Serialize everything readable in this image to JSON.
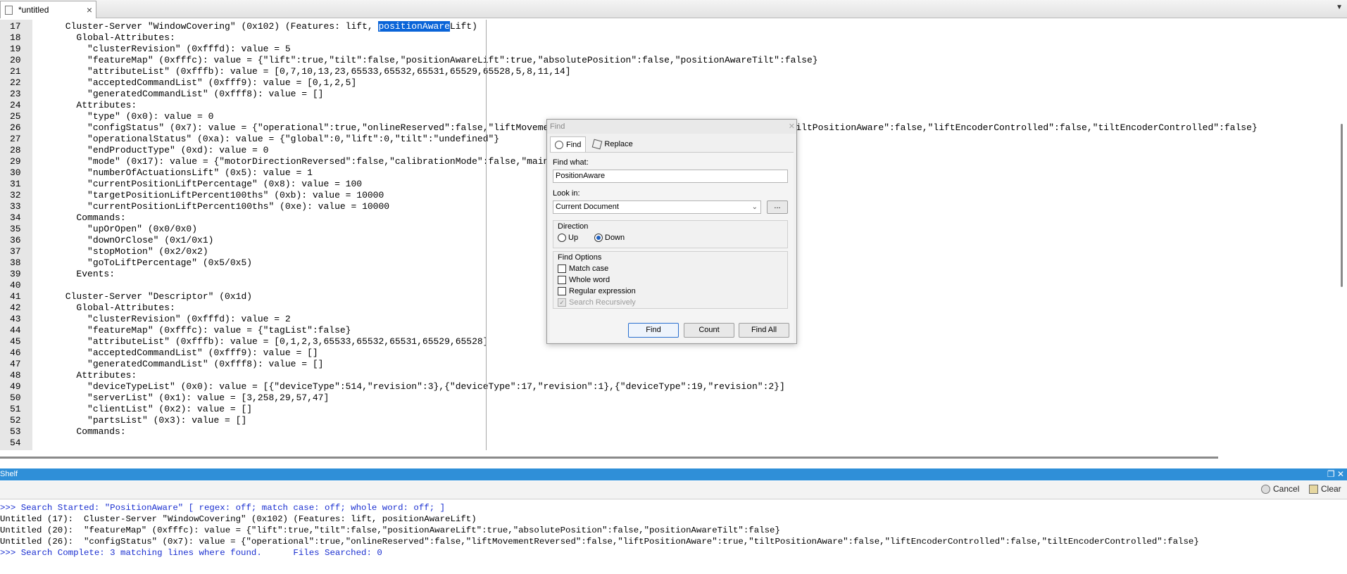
{
  "tab": {
    "title": "*untitled",
    "close": "×",
    "menu": "▼"
  },
  "editor": {
    "lines": [
      {
        "n": "17",
        "pre": "      Cluster-Server \"WindowCovering\" (0x102) (Features: lift, ",
        "sel": "positionAware",
        "post": "Lift)"
      },
      {
        "n": "18",
        "pre": "        Global-Attributes:"
      },
      {
        "n": "19",
        "pre": "          \"clusterRevision\" (0xfffd): value = 5"
      },
      {
        "n": "20",
        "pre": "          \"featureMap\" (0xfffc): value = {\"lift\":true,\"tilt\":false,\"positionAwareLift\":true,\"absolutePosition\":false,\"positionAwareTilt\":false}"
      },
      {
        "n": "21",
        "pre": "          \"attributeList\" (0xfffb): value = [0,7,10,13,23,65533,65532,65531,65529,65528,5,8,11,14]"
      },
      {
        "n": "22",
        "pre": "          \"acceptedCommandList\" (0xfff9): value = [0,1,2,5]"
      },
      {
        "n": "23",
        "pre": "          \"generatedCommandList\" (0xfff8): value = []"
      },
      {
        "n": "24",
        "pre": "        Attributes:"
      },
      {
        "n": "25",
        "pre": "          \"type\" (0x0): value = 0"
      },
      {
        "n": "26",
        "pre": "          \"configStatus\" (0x7): value = {\"operational\":true,\"onlineReserved\":false,\"liftMovementReversed\":false,\"liftPositionAware\":true,\"tiltPositionAware\":false,\"liftEncoderControlled\":false,\"tiltEncoderControlled\":false}"
      },
      {
        "n": "27",
        "pre": "          \"operationalStatus\" (0xa): value = {\"global\":0,\"lift\":0,\"tilt\":\"undefined\"}"
      },
      {
        "n": "28",
        "pre": "          \"endProductType\" (0xd): value = 0"
      },
      {
        "n": "29",
        "pre": "          \"mode\" (0x17): value = {\"motorDirectionReversed\":false,\"calibrationMode\":false,\"maintenanceMode\":false,\"ledFeedback\":false}"
      },
      {
        "n": "30",
        "pre": "          \"numberOfActuationsLift\" (0x5): value = 1"
      },
      {
        "n": "31",
        "pre": "          \"currentPositionLiftPercentage\" (0x8): value = 100"
      },
      {
        "n": "32",
        "pre": "          \"targetPositionLiftPercent100ths\" (0xb): value = 10000"
      },
      {
        "n": "33",
        "pre": "          \"currentPositionLiftPercent100ths\" (0xe): value = 10000"
      },
      {
        "n": "34",
        "pre": "        Commands:"
      },
      {
        "n": "35",
        "pre": "          \"upOrOpen\" (0x0/0x0)"
      },
      {
        "n": "36",
        "pre": "          \"downOrClose\" (0x1/0x1)"
      },
      {
        "n": "37",
        "pre": "          \"stopMotion\" (0x2/0x2)"
      },
      {
        "n": "38",
        "pre": "          \"goToLiftPercentage\" (0x5/0x5)"
      },
      {
        "n": "39",
        "pre": "        Events:"
      },
      {
        "n": "40",
        "pre": ""
      },
      {
        "n": "41",
        "pre": "      Cluster-Server \"Descriptor\" (0x1d)"
      },
      {
        "n": "42",
        "pre": "        Global-Attributes:"
      },
      {
        "n": "43",
        "pre": "          \"clusterRevision\" (0xfffd): value = 2"
      },
      {
        "n": "44",
        "pre": "          \"featureMap\" (0xfffc): value = {\"tagList\":false}"
      },
      {
        "n": "45",
        "pre": "          \"attributeList\" (0xfffb): value = [0,1,2,3,65533,65532,65531,65529,65528]"
      },
      {
        "n": "46",
        "pre": "          \"acceptedCommandList\" (0xfff9): value = []"
      },
      {
        "n": "47",
        "pre": "          \"generatedCommandList\" (0xfff8): value = []"
      },
      {
        "n": "48",
        "pre": "        Attributes:"
      },
      {
        "n": "49",
        "pre": "          \"deviceTypeList\" (0x0): value = [{\"deviceType\":514,\"revision\":3},{\"deviceType\":17,\"revision\":1},{\"deviceType\":19,\"revision\":2}]"
      },
      {
        "n": "50",
        "pre": "          \"serverList\" (0x1): value = [3,258,29,57,47]"
      },
      {
        "n": "51",
        "pre": "          \"clientList\" (0x2): value = []"
      },
      {
        "n": "52",
        "pre": "          \"partsList\" (0x3): value = []"
      },
      {
        "n": "53",
        "pre": "        Commands:"
      },
      {
        "n": "54",
        "pre": ""
      }
    ]
  },
  "find_dialog": {
    "title": "Find",
    "close": "✕",
    "tab_find": "Find",
    "tab_replace": "Replace",
    "find_what_label": "Find what:",
    "find_what_value": "PositionAware",
    "look_in_label": "Look in:",
    "look_in_value": "Current Document",
    "browse": "...",
    "direction_label": "Direction",
    "dir_up": "Up",
    "dir_down": "Down",
    "direction_selected": "Down",
    "options_label": "Find Options",
    "match_case": "Match case",
    "whole_word": "Whole word",
    "regex": "Regular expression",
    "search_recursively": "Search Recursively",
    "btn_find": "Find",
    "btn_count": "Count",
    "btn_find_all": "Find All"
  },
  "shelf": {
    "title": "Shelf",
    "cancel": "Cancel",
    "clear": "Clear",
    "output": [
      {
        "text": ">>> Search Started: \"PositionAware\" [ regex: off; match case: off; whole word: off; ]",
        "color": "#1a2fd0"
      },
      {
        "text": "Untitled (17):  Cluster-Server \"WindowCovering\" (0x102) (Features: lift, positionAwareLift)",
        "color": "#000000"
      },
      {
        "text": "Untitled (20):  \"featureMap\" (0xfffc): value = {\"lift\":true,\"tilt\":false,\"positionAwareLift\":true,\"absolutePosition\":false,\"positionAwareTilt\":false}",
        "color": "#000000"
      },
      {
        "text": "Untitled (26):  \"configStatus\" (0x7): value = {\"operational\":true,\"onlineReserved\":false,\"liftMovementReversed\":false,\"liftPositionAware\":true,\"tiltPositionAware\":false,\"liftEncoderControlled\":false,\"tiltEncoderControlled\":false}",
        "color": "#000000"
      },
      {
        "text": ">>> Search Complete: 3 matching lines where found.      Files Searched: 0",
        "color": "#1a2fd0"
      }
    ]
  },
  "colors": {
    "selection": "#0a64d8",
    "shelf_bar": "#2f8fd8",
    "gutter": "#e6e6e6"
  }
}
